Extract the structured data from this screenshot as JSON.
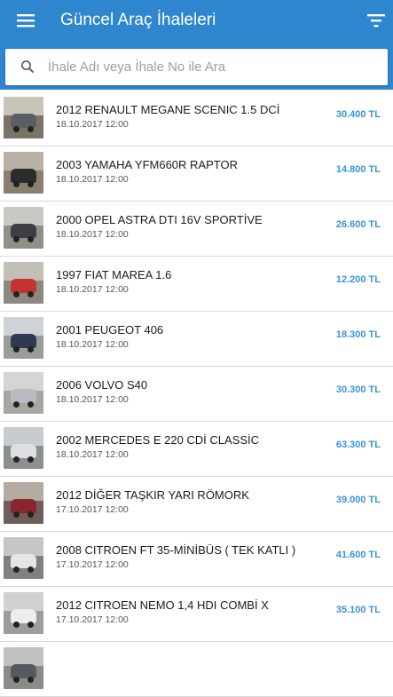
{
  "header": {
    "title": "Güncel Araç İhaleleri",
    "menu_icon": "menu-icon",
    "filter_icon": "filter-icon",
    "accent_color": "#2e86cf"
  },
  "search": {
    "placeholder": "İhale Adı veya İhale No ile Ara",
    "value": "",
    "icon": "search-icon"
  },
  "listings": [
    {
      "name": "2012 RENAULT MEGANE SCENIC 1.5 DCİ",
      "date": "18.10.2017 12:00",
      "price": "30.400 TL",
      "sky": "#c9c4b8",
      "ground": "#7a7468",
      "car": "#5a5f66"
    },
    {
      "name": "2003 YAMAHA YFM660R RAPTOR",
      "date": "18.10.2017 12:00",
      "price": "14.800 TL",
      "sky": "#b9b2a4",
      "ground": "#8a8070",
      "car": "#2b2b2b"
    },
    {
      "name": "2000 OPEL ASTRA DTI 16V SPORTİVE",
      "date": "18.10.2017 12:00",
      "price": "26.600 TL",
      "sky": "#c7c9c4",
      "ground": "#8f9088",
      "car": "#3d3f44"
    },
    {
      "name": "1997 FIAT MAREA 1.6",
      "date": "18.10.2017 12:00",
      "price": "12.200 TL",
      "sky": "#c2bfb6",
      "ground": "#8c8a80",
      "car": "#c4332d"
    },
    {
      "name": "2001 PEUGEOT 406",
      "date": "18.10.2017 12:00",
      "price": "18.300 TL",
      "sky": "#cfd3d6",
      "ground": "#9a9c98",
      "car": "#2f3a52"
    },
    {
      "name": "2006 VOLVO S40",
      "date": "18.10.2017 12:00",
      "price": "30.300 TL",
      "sky": "#d4d6d3",
      "ground": "#a6a79f",
      "car": "#b8bcc0"
    },
    {
      "name": "2002 MERCEDES E 220 CDİ CLASSİC",
      "date": "18.10.2017 12:00",
      "price": "63.300 TL",
      "sky": "#c6ccd0",
      "ground": "#8b8f8e",
      "car": "#dde0e3"
    },
    {
      "name": "2012 DİĞER TAŞKIR YARI RÖMORK",
      "date": "17.10.2017 12:00",
      "price": "39.000 TL",
      "sky": "#b4aaa0",
      "ground": "#6e5f58",
      "car": "#8a2530"
    },
    {
      "name": "2008 CITROEN FT 35-MİNİBÜS ( TEK KATLI )",
      "date": "17.10.2017 12:00",
      "price": "41.600 TL",
      "sky": "#c5c7c6",
      "ground": "#7f817f",
      "car": "#e4e6e6"
    },
    {
      "name": "2012 CITROEN NEMO 1,4 HDI COMBİ X",
      "date": "17.10.2017 12:00",
      "price": "35.100 TL",
      "sky": "#cfd1cf",
      "ground": "#9d9e9a",
      "car": "#eceeed"
    },
    {
      "name": "",
      "date": "",
      "price": "",
      "sky": "#c0c2c0",
      "ground": "#8a8c88",
      "car": "#555a60"
    }
  ]
}
